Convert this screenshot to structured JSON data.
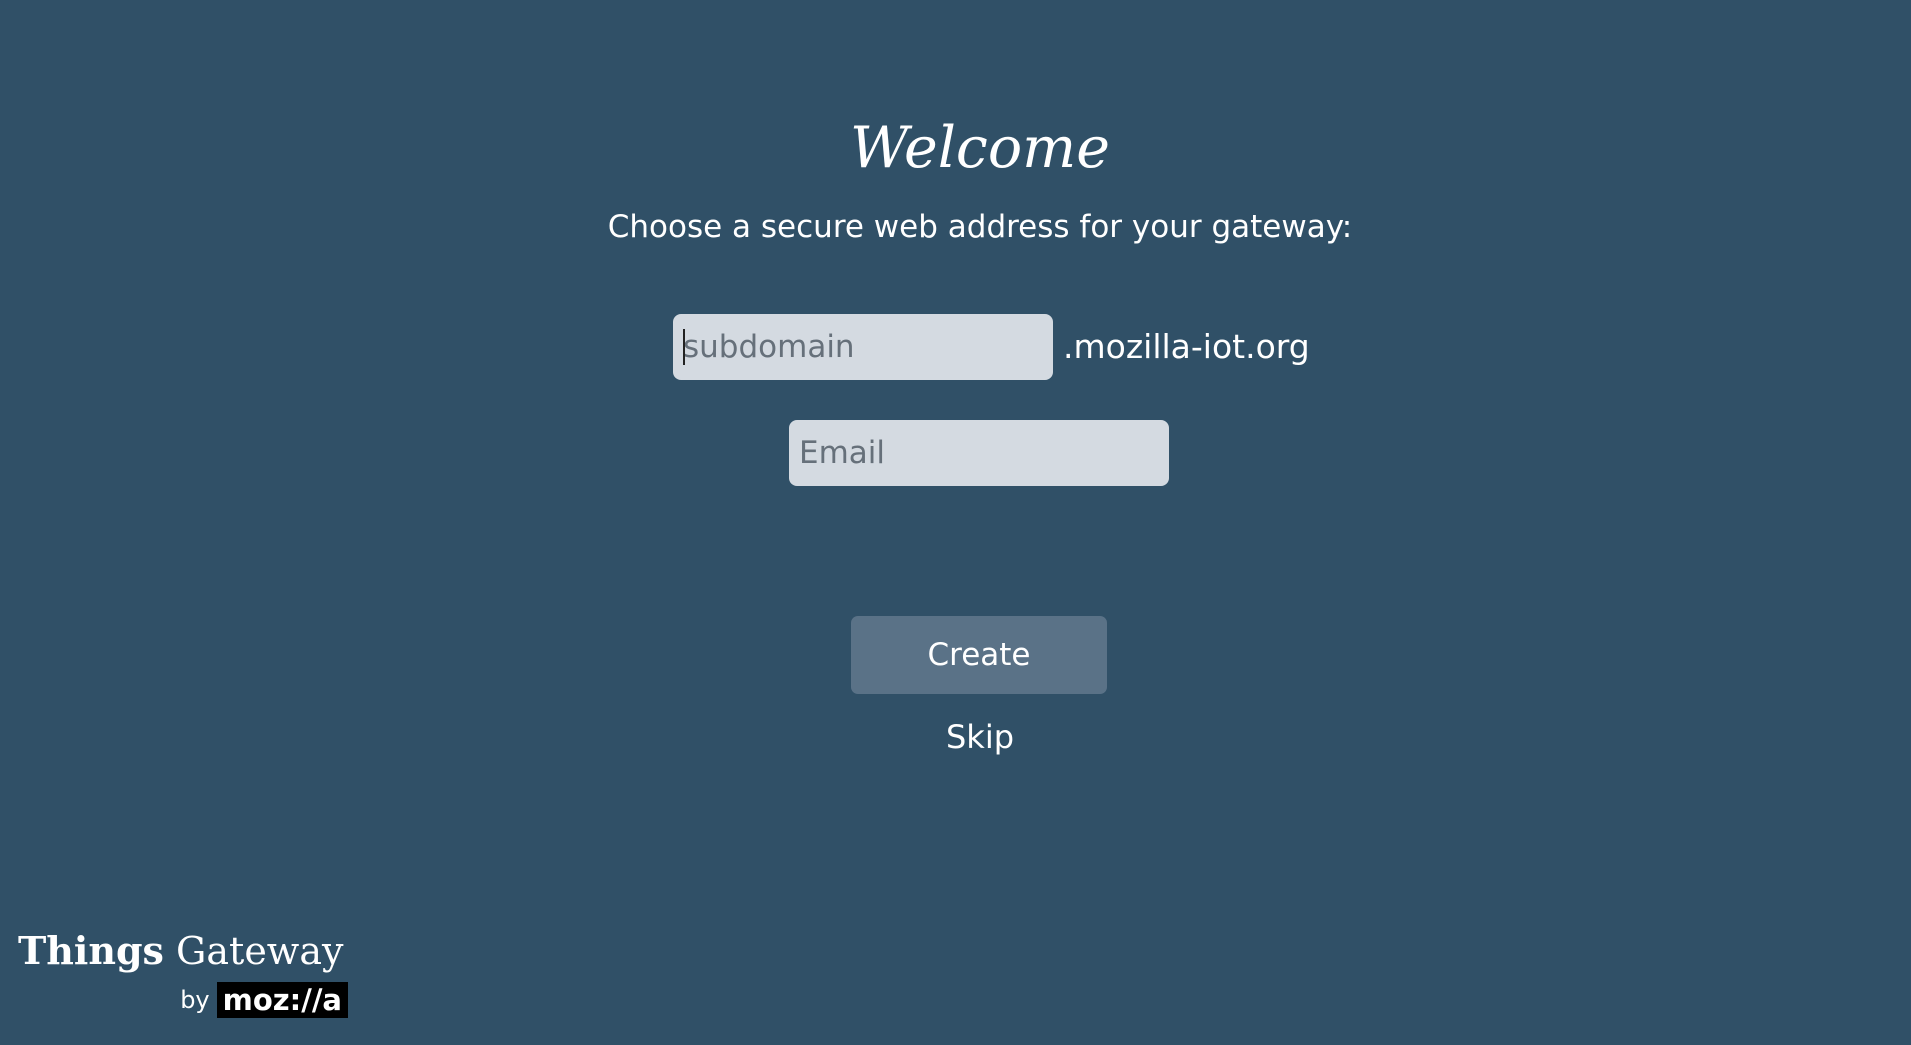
{
  "welcome": {
    "title": "Welcome",
    "subtitle": "Choose a secure web address for your gateway:"
  },
  "form": {
    "subdomain_placeholder": "subdomain",
    "domain_suffix": ".mozilla-iot.org",
    "email_placeholder": "Email",
    "create_label": "Create",
    "skip_label": "Skip"
  },
  "brand": {
    "things": "Things",
    "gateway": "Gateway",
    "by": "by",
    "mozilla_logo": "moz://a"
  },
  "colors": {
    "background": "#305067",
    "input_background": "#d4dae1",
    "button_background": "#5a7287"
  }
}
